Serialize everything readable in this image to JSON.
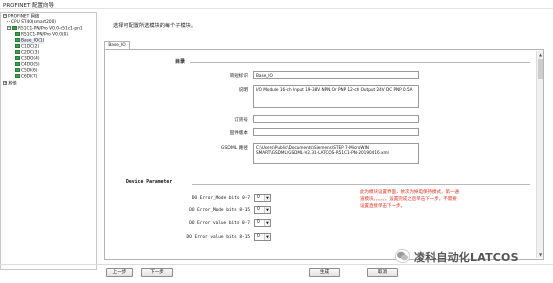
{
  "window": {
    "title": "PROFINET 配置向导"
  },
  "tree": {
    "items": [
      {
        "label": "PROFINET 网络",
        "expander": "−",
        "icon": false,
        "selected": false
      },
      {
        "label": "CPU ST40(smart200)",
        "expander": "",
        "icon": false,
        "selected": false
      },
      {
        "label": "R51C1-PN/Pro V0.0-r51c1-pn1",
        "expander": "−",
        "icon": true,
        "selected": false
      },
      {
        "label": "R51C1-PN/Pro V0.0(0)",
        "expander": "",
        "icon": true,
        "selected": false
      },
      {
        "label": "Base_IO(1)",
        "expander": "",
        "icon": true,
        "selected": true
      },
      {
        "label": "C1DC(2)",
        "expander": "",
        "icon": true,
        "selected": false
      },
      {
        "label": "C2DC(3)",
        "expander": "",
        "icon": true,
        "selected": false
      },
      {
        "label": "C3DO(4)",
        "expander": "",
        "icon": true,
        "selected": false
      },
      {
        "label": "C4DO(5)",
        "expander": "",
        "icon": true,
        "selected": false
      },
      {
        "label": "C5DI(6)",
        "expander": "",
        "icon": true,
        "selected": false
      },
      {
        "label": "C6DI(7)",
        "expander": "",
        "icon": true,
        "selected": false
      },
      {
        "label": "其他",
        "expander": "+",
        "icon": false,
        "selected": false
      }
    ]
  },
  "main": {
    "header_message": "选择可配置所选模块的每个子模块。",
    "tab_label": "Base_IO",
    "section_title": "目录",
    "fields": [
      {
        "label": "简短标识",
        "value": "Base_IO"
      },
      {
        "label": "说明",
        "value": "I/O Module 16-ch Input 19-38V NPN Or PNP 12-ch Output 24V DC PNP 0.5A"
      },
      {
        "label": "订货号",
        "value": ""
      },
      {
        "label": "固件版本",
        "value": ""
      },
      {
        "label": "GSDML 路径",
        "value": "C:\\Users\\Public\\Documents\\Siemens\\STEP 7-MicroWIN SMART\\GSDML\\GSDML-V2.31-LATCOS-R51C1-PN-20190416.xml"
      }
    ],
    "param_title": "Device Parameter",
    "params": [
      {
        "label": "DO Error_Mode bits 0-7",
        "value": "0"
      },
      {
        "label": "DO Error_Mode bits 8-15",
        "value": "0"
      },
      {
        "label": "DO Error value bits 0-7",
        "value": "0"
      },
      {
        "label": "DO Error value bits 8-15",
        "value": "0"
      }
    ],
    "note": "此为模块设置界面，依次为掉电保持模式，第一通道模块。。。。。。设置完成之后单击下一步，不需要设置直接单击下一步。"
  },
  "footer": {
    "prev_label": "上一步",
    "next_label": "下一步",
    "generate_label": "生成",
    "cancel_label": "取消"
  },
  "watermark": {
    "text": "凌科自动化LATCOS"
  },
  "colors": {
    "note": "#e0301e",
    "tree_icon": "#3fa34d"
  }
}
